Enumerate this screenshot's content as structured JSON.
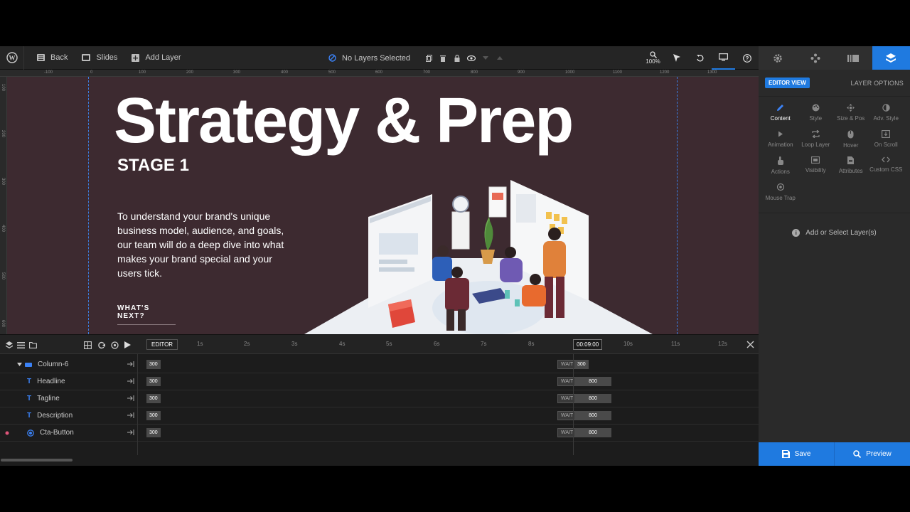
{
  "toolbar": {
    "back_label": "Back",
    "slides_label": "Slides",
    "add_layer_label": "Add Layer",
    "selection_status": "No Layers Selected",
    "zoom_level": "100%"
  },
  "panel": {
    "editor_view_label": "EDITOR VIEW",
    "layer_options_label": "LAYER OPTIONS",
    "options": [
      {
        "label": "Content",
        "icon": "pencil-icon",
        "active": true
      },
      {
        "label": "Style",
        "icon": "palette-icon"
      },
      {
        "label": "Size & Pos",
        "icon": "move-icon"
      },
      {
        "label": "Adv. Style",
        "icon": "contrast-icon"
      },
      {
        "label": "Animation",
        "icon": "play-icon"
      },
      {
        "label": "Loop Layer",
        "icon": "loop-icon"
      },
      {
        "label": "Hover",
        "icon": "mouse-icon"
      },
      {
        "label": "On Scroll",
        "icon": "scroll-icon"
      },
      {
        "label": "Actions",
        "icon": "hand-icon"
      },
      {
        "label": "Visibility",
        "icon": "visibility-icon"
      },
      {
        "label": "Attributes",
        "icon": "file-icon"
      },
      {
        "label": "Custom CSS",
        "icon": "code-icon"
      },
      {
        "label": "Mouse Trap",
        "icon": "crosshair-icon"
      }
    ],
    "add_select_label": "Add or Select Layer(s)",
    "save_label": "Save",
    "preview_label": "Preview"
  },
  "rulers": {
    "horizontal": [
      "-100",
      "0",
      "100",
      "200",
      "300",
      "400",
      "500",
      "600",
      "700",
      "800",
      "900",
      "1000",
      "1100",
      "1200",
      "1300"
    ],
    "vertical": [
      "100",
      "200",
      "300",
      "400",
      "500",
      "600"
    ]
  },
  "canvas": {
    "headline": "Strategy & Prep",
    "tagline": "STAGE 1",
    "description": "To understand your brand's unique business model, audience, and goals, our team will do a deep dive into what makes your brand special and your users tick.",
    "cta": "WHAT'S NEXT?",
    "background_color": "#3d2a30"
  },
  "timeline": {
    "editor_label": "EDITOR",
    "ticks": [
      "1s",
      "2s",
      "3s",
      "4s",
      "5s",
      "6s",
      "7s",
      "8s",
      "10s",
      "11s",
      "12s"
    ],
    "current_time": "00:09:00",
    "rows": [
      {
        "name": "Column-6",
        "start": "300",
        "wait": "WAIT",
        "duration": "300"
      },
      {
        "name": "Headline",
        "start": "300",
        "wait": "WAIT",
        "duration": "800"
      },
      {
        "name": "Tagline",
        "start": "300",
        "wait": "WAIT",
        "duration": "800"
      },
      {
        "name": "Description",
        "start": "300",
        "wait": "WAIT",
        "duration": "800"
      },
      {
        "name": "Cta-Button",
        "start": "300",
        "wait": "WAIT",
        "duration": "800"
      }
    ]
  },
  "colors": {
    "accent": "#1f7ae0",
    "panel": "#2a2a2a"
  }
}
